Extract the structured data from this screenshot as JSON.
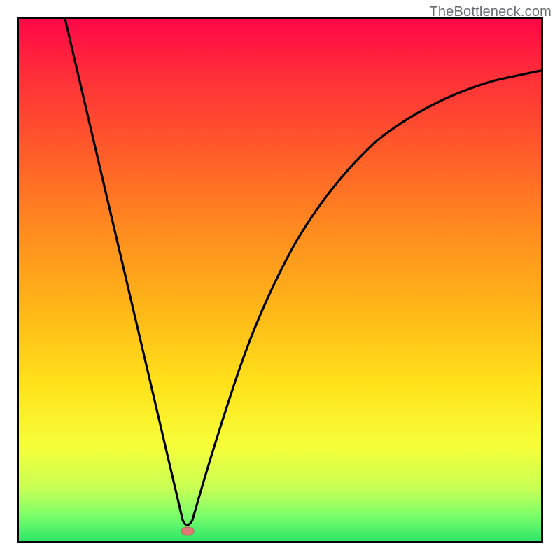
{
  "watermark": "TheBottleneck.com",
  "colors": {
    "gradient_top": "#ff0747",
    "gradient_mid": "#ffe21a",
    "gradient_bottom": "#2fe569",
    "curve": "#000000",
    "marker_fill": "#e07a7a",
    "marker_stroke": "#c05a5a",
    "frame": "#000000"
  },
  "chart_data": {
    "type": "line",
    "title": "",
    "xlabel": "",
    "ylabel": "",
    "x_range": [
      0,
      100
    ],
    "y_range": [
      0,
      100
    ],
    "note": "No numeric axes or tick labels are shown; values are percent-of-frame estimates read off the image.",
    "series": [
      {
        "name": "bottleneck-curve",
        "x": [
          8.8,
          15,
          20,
          25,
          30,
          31.4,
          32.3,
          33.5,
          36,
          40,
          45,
          50,
          55,
          60,
          65,
          70,
          75,
          80,
          85,
          90,
          95,
          100
        ],
        "y": [
          100,
          78,
          60,
          42,
          14,
          4,
          2,
          4,
          16,
          30,
          43,
          53,
          61,
          68,
          74,
          79,
          82.5,
          85.5,
          87.6,
          89,
          89.8,
          90.1
        ]
      }
    ],
    "markers": [
      {
        "name": "vertex",
        "x": 32.3,
        "y": 1.9,
        "shape": "ellipse",
        "color": "#e07a7a"
      }
    ],
    "background_gradient": {
      "direction": "top-to-bottom",
      "stops": [
        {
          "pos": 0,
          "color": "#ff0747"
        },
        {
          "pos": 25,
          "color": "#ff5a2a"
        },
        {
          "pos": 55,
          "color": "#ffb518"
        },
        {
          "pos": 82,
          "color": "#f6ff3a"
        },
        {
          "pos": 100,
          "color": "#2fe569"
        }
      ]
    }
  }
}
